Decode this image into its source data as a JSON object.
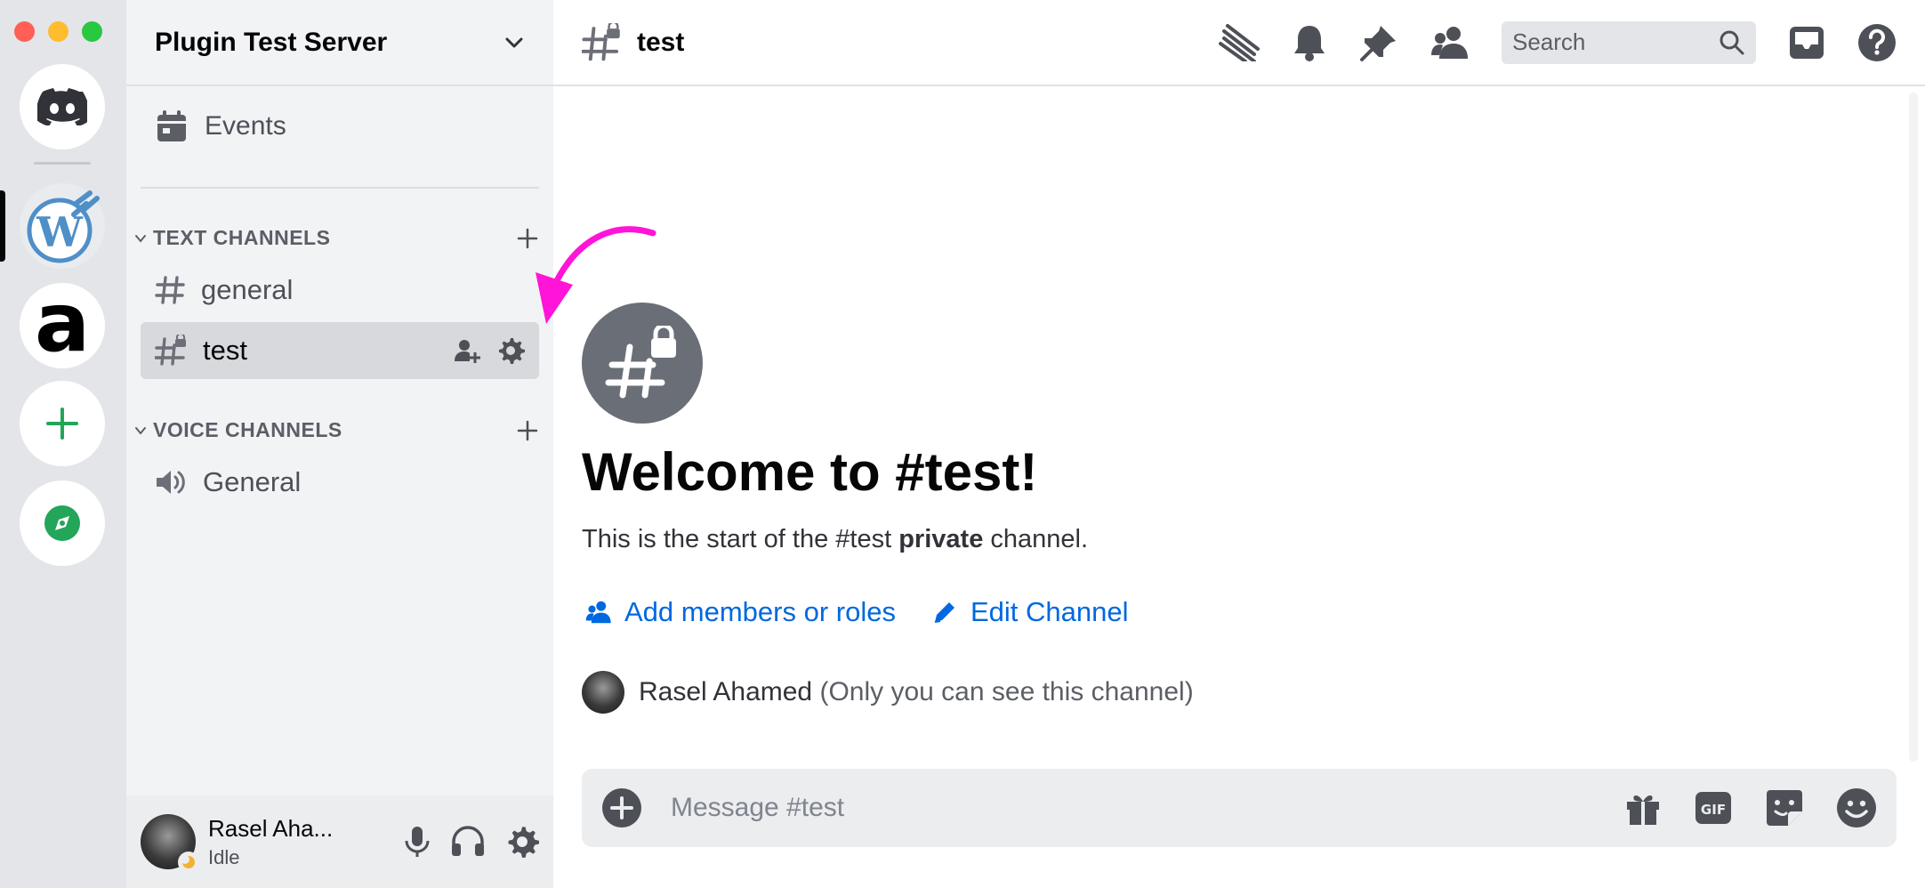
{
  "window": {
    "traffic_colors": [
      "#ff5f57",
      "#febc2e",
      "#28c840"
    ]
  },
  "server_rail": {
    "items": [
      "discord-home-icon",
      "wordpress-plugin-server",
      "a-server",
      "add-server",
      "explore-servers"
    ]
  },
  "sidebar": {
    "server_name": "Plugin Test Server",
    "events_label": "Events",
    "text_category": "TEXT CHANNELS",
    "voice_category": "VOICE CHANNELS",
    "text_channels": [
      {
        "name": "general"
      },
      {
        "name": "test",
        "selected": true
      }
    ],
    "voice_channels": [
      {
        "name": "General"
      }
    ]
  },
  "user_panel": {
    "name": "Rasel Aha...",
    "status": "Idle"
  },
  "header": {
    "channel": "test",
    "search_placeholder": "Search"
  },
  "welcome": {
    "title": "Welcome to #test!",
    "desc_prefix": "This is the start of the #test ",
    "desc_bold": "private",
    "desc_suffix": " channel.",
    "add_members": "Add members or roles",
    "edit_channel": "Edit Channel",
    "user_name": "Rasel Ahamed",
    "visibility_note": "(Only you can see this channel)"
  },
  "composer": {
    "placeholder": "Message #test"
  },
  "colors": {
    "accent_link": "#0068e0",
    "annotation_arrow": "#ff14d8",
    "add_server_green": "#23a55a"
  }
}
